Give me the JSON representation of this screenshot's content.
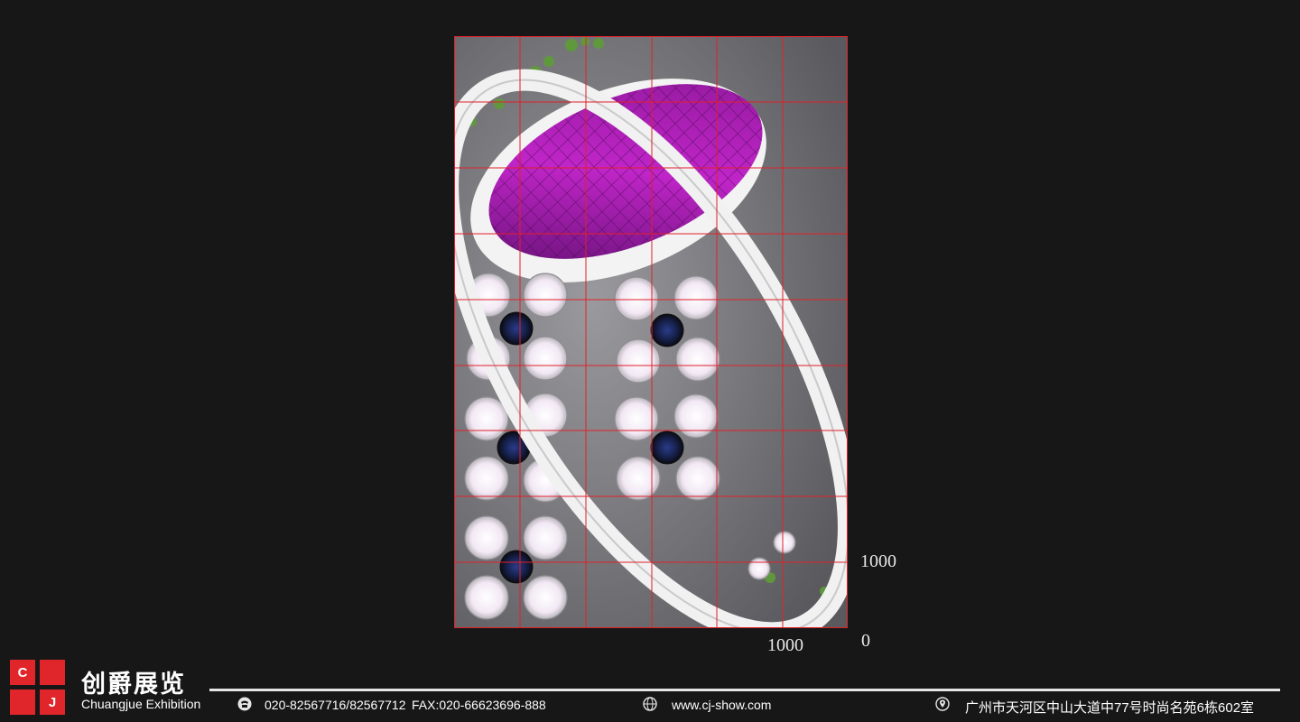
{
  "scale": {
    "x_label": "1000",
    "y_label": "1000",
    "origin": "0"
  },
  "brand": {
    "logo_letters": [
      "C",
      "J"
    ],
    "name_cn": "创爵展览",
    "name_en": "Chuangjue Exhibition"
  },
  "contact": {
    "phone": "020-82567716/82567712",
    "fax": "FAX:020-66623696-888",
    "website": "www.cj-show.com",
    "address": "广州市天河区中山大道中77号时尚名苑6栋602室"
  },
  "icons": {
    "phone": "phone-icon",
    "web": "globe-icon",
    "address": "location-pin-icon"
  },
  "colors": {
    "brand_red": "#e0262b",
    "grid_red": "#e0202a",
    "canopy_magenta": "#b01fb8"
  }
}
